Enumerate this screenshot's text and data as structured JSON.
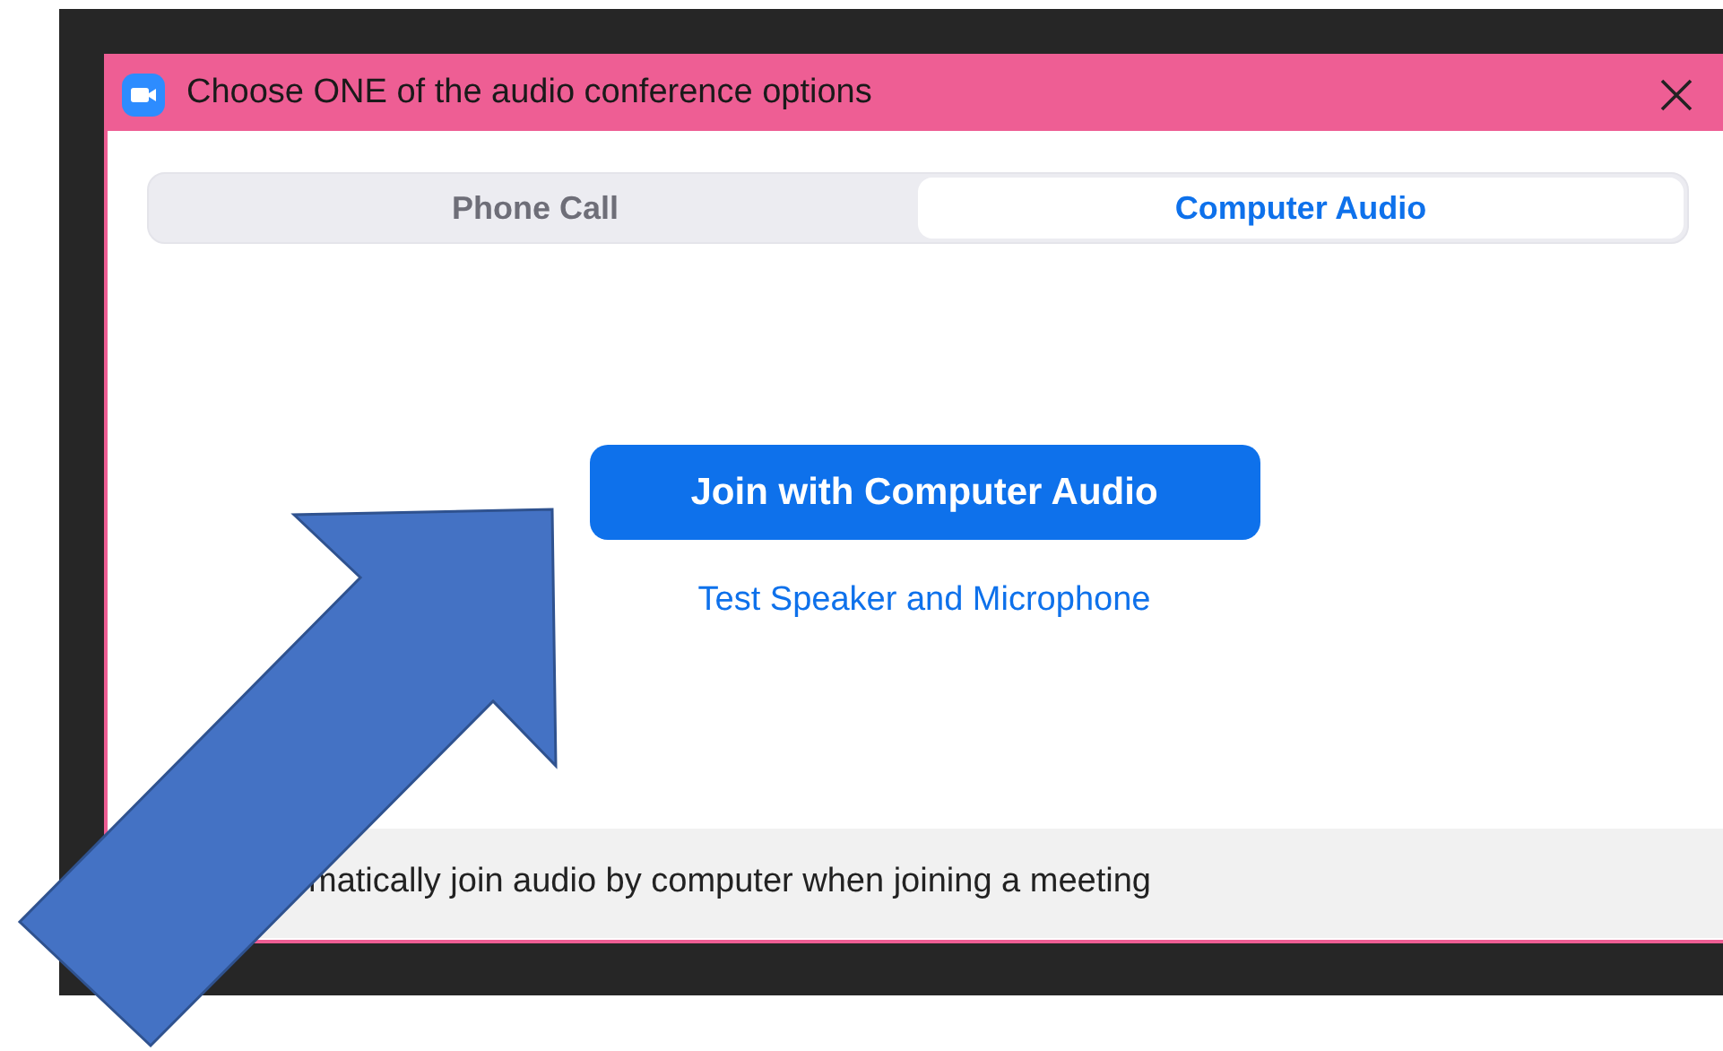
{
  "window": {
    "title": "Choose ONE of the audio conference options"
  },
  "tabs": [
    {
      "label": "Phone Call",
      "selected": false
    },
    {
      "label": "Computer Audio",
      "selected": true
    }
  ],
  "join_button": "Join with Computer Audio",
  "test_link": "Test Speaker and Microphone",
  "footer": {
    "text": "matically join audio by computer when joining a meeting"
  }
}
